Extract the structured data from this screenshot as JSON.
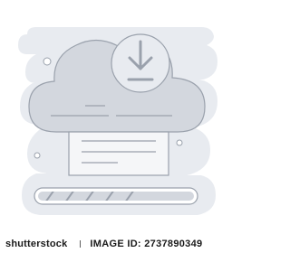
{
  "watermark": {
    "brand": "shutterstock",
    "image_id": "IMAGE ID: 2737890349"
  },
  "colors": {
    "blob": "#e8ebf0",
    "cloud": "#d3d7de",
    "outline": "#9aa1ac",
    "paper": "#f5f6f8",
    "line": "#9aa1ac"
  },
  "icon": "download-icon",
  "progress": 1.0
}
